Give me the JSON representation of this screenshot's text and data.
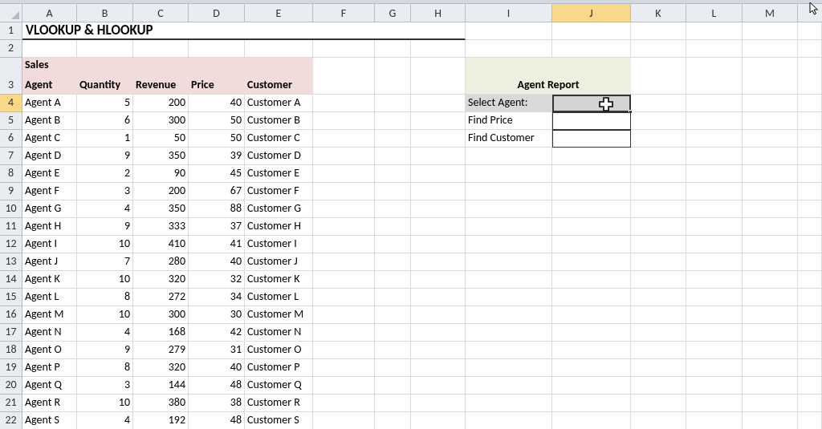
{
  "column_headers": [
    {
      "label": "A",
      "selected": false
    },
    {
      "label": "B",
      "selected": false
    },
    {
      "label": "C",
      "selected": false
    },
    {
      "label": "D",
      "selected": false
    },
    {
      "label": "E",
      "selected": false
    },
    {
      "label": "F",
      "selected": false
    },
    {
      "label": "G",
      "selected": false
    },
    {
      "label": "H",
      "selected": false
    },
    {
      "label": "I",
      "selected": false
    },
    {
      "label": "J",
      "selected": true
    },
    {
      "label": "K",
      "selected": false
    },
    {
      "label": "L",
      "selected": false
    },
    {
      "label": "M",
      "selected": false
    }
  ],
  "row_numbers": [
    {
      "label": "1",
      "selected": false
    },
    {
      "label": "2",
      "selected": false
    },
    {
      "label": "3",
      "selected": false
    },
    {
      "label": "4",
      "selected": true
    },
    {
      "label": "5",
      "selected": false
    },
    {
      "label": "6",
      "selected": false
    },
    {
      "label": "7",
      "selected": false
    },
    {
      "label": "8",
      "selected": false
    },
    {
      "label": "9",
      "selected": false
    },
    {
      "label": "10",
      "selected": false
    },
    {
      "label": "11",
      "selected": false
    },
    {
      "label": "12",
      "selected": false
    },
    {
      "label": "13",
      "selected": false
    },
    {
      "label": "14",
      "selected": false
    },
    {
      "label": "15",
      "selected": false
    },
    {
      "label": "16",
      "selected": false
    },
    {
      "label": "17",
      "selected": false
    },
    {
      "label": "18",
      "selected": false
    },
    {
      "label": "19",
      "selected": false
    },
    {
      "label": "20",
      "selected": false
    },
    {
      "label": "21",
      "selected": false
    },
    {
      "label": "22",
      "selected": false
    }
  ],
  "title": "VLOOKUP & HLOOKUP",
  "sales": {
    "caption": "Sales",
    "headers": [
      "Agent",
      "Quantity",
      "Revenue",
      "Price",
      "Customer"
    ],
    "rows": [
      [
        "Agent A",
        "5",
        "200",
        "40",
        "Customer A"
      ],
      [
        "Agent B",
        "6",
        "300",
        "50",
        "Customer B"
      ],
      [
        "Agent C",
        "1",
        "50",
        "50",
        "Customer C"
      ],
      [
        "Agent D",
        "9",
        "350",
        "39",
        "Customer D"
      ],
      [
        "Agent E",
        "2",
        "90",
        "45",
        "Customer E"
      ],
      [
        "Agent F",
        "3",
        "200",
        "67",
        "Customer F"
      ],
      [
        "Agent G",
        "4",
        "350",
        "88",
        "Customer G"
      ],
      [
        "Agent H",
        "9",
        "333",
        "37",
        "Customer H"
      ],
      [
        "Agent I",
        "10",
        "410",
        "41",
        "Customer I"
      ],
      [
        "Agent J",
        "7",
        "280",
        "40",
        "Customer J"
      ],
      [
        "Agent K",
        "10",
        "320",
        "32",
        "Customer K"
      ],
      [
        "Agent L",
        "8",
        "272",
        "34",
        "Customer L"
      ],
      [
        "Agent M",
        "10",
        "300",
        "30",
        "Customer M"
      ],
      [
        "Agent N",
        "4",
        "168",
        "42",
        "Customer N"
      ],
      [
        "Agent O",
        "9",
        "279",
        "31",
        "Customer O"
      ],
      [
        "Agent P",
        "8",
        "320",
        "40",
        "Customer P"
      ],
      [
        "Agent Q",
        "3",
        "144",
        "48",
        "Customer Q"
      ],
      [
        "Agent R",
        "10",
        "380",
        "38",
        "Customer R"
      ],
      [
        "Agent S",
        "4",
        "192",
        "48",
        "Customer S"
      ]
    ]
  },
  "agent_report": {
    "title": "Agent Report",
    "fields": [
      {
        "label": "Select Agent:",
        "selected": true
      },
      {
        "label": "Find Price",
        "selected": false
      },
      {
        "label": "Find Customer",
        "selected": false
      }
    ]
  }
}
